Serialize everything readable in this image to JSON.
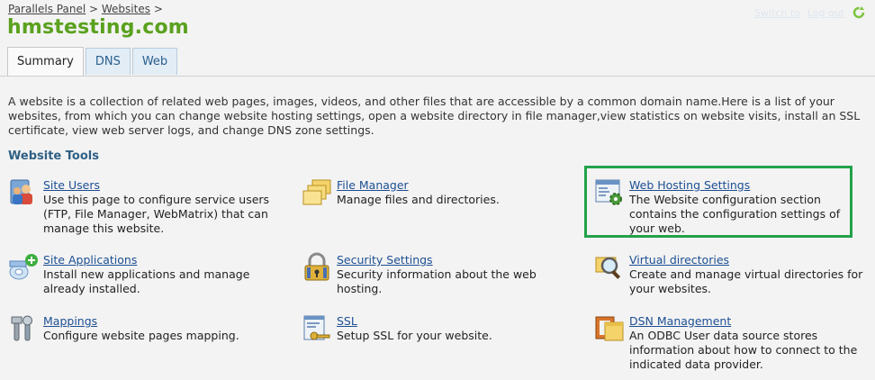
{
  "breadcrumb": {
    "items": [
      "Parallels Panel",
      "Websites"
    ],
    "separator": ">"
  },
  "header": {
    "title": "hmstesting.com",
    "faded_links": [
      "Switch to",
      "Log out"
    ]
  },
  "tabs": [
    {
      "label": "Summary",
      "active": true
    },
    {
      "label": "DNS",
      "active": false
    },
    {
      "label": "Web",
      "active": false
    }
  ],
  "description": "A website is a collection of related web pages, images, videos, and other files that are accessible by a common domain name.Here is a list of your websites, from which you can change website hosting settings, open a website directory in file manager,view statistics on website visits, install an SSL certificate, view web server logs, and change DNS zone settings.",
  "section": {
    "title": "Website Tools"
  },
  "tools": [
    {
      "title": "Site Users",
      "desc": "Use this page to configure service users (FTP, File Manager, WebMatrix) that can manage this website.",
      "icon": "users-icon"
    },
    {
      "title": "File Manager",
      "desc": "Manage files and directories.",
      "icon": "folders-icon"
    },
    {
      "title": "Web Hosting Settings",
      "desc": "The Website configuration section contains the configuration settings of your web.",
      "icon": "settings-window-icon"
    },
    {
      "title": "Site Applications",
      "desc": "Install new applications and manage already installed.",
      "icon": "apps-add-icon"
    },
    {
      "title": "Security Settings",
      "desc": "Security information about the web hosting.",
      "icon": "padlock-icon"
    },
    {
      "title": "Virtual directories",
      "desc": "Create and manage virtual directories for your websites.",
      "icon": "magnifier-icon"
    },
    {
      "title": "Mappings",
      "desc": "Configure website pages mapping.",
      "icon": "tools-icon"
    },
    {
      "title": "SSL",
      "desc": "Setup SSL for your website.",
      "icon": "key-certificate-icon"
    },
    {
      "title": "DSN Management",
      "desc": "An ODBC User data source stores information about how to connect to the indicated data provider.",
      "icon": "database-folder-icon"
    }
  ],
  "colors": {
    "title_green": "#5aa11e",
    "link_blue": "#1d4f93",
    "highlight": "#22a24a"
  }
}
